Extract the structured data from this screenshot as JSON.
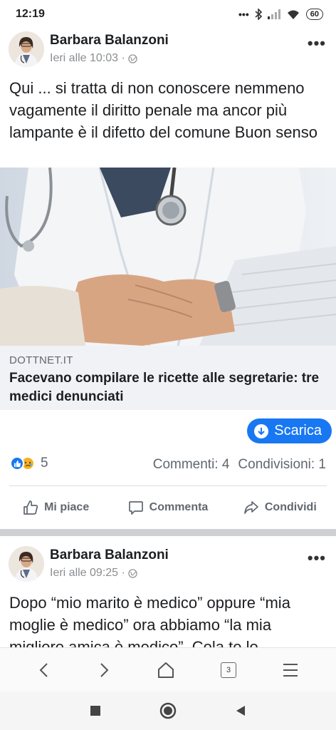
{
  "status_bar": {
    "time": "12:19",
    "battery": "60"
  },
  "posts": [
    {
      "author": "Barbara Balanzoni",
      "time": "Ieri alle 10:03 ·",
      "text": "Qui ... si tratta di non conoscere nemmeno vagamente il diritto penale ma ancor più lampante è il difetto del comune Buon senso"
    },
    {
      "author": "Barbara Balanzoni",
      "time": "Ieri alle 09:25 ·",
      "text": "Dopo “mio marito è medico” oppure “mia moglie è medico” ora abbiamo “la mia migliore amica è medico”. Cola te lo"
    }
  ],
  "link_preview": {
    "domain": "DOTTNET.IT",
    "title": "Facevano compilare le ricette alle segretarie: tre medici denunciati"
  },
  "download_button": "Scarica",
  "reactions": {
    "count": "5"
  },
  "stats": {
    "comments": "Commenti: 4",
    "shares": "Condivisioni: 1"
  },
  "actions": {
    "like": "Mi piace",
    "comment": "Commenta",
    "share": "Condividi"
  },
  "browser": {
    "tab_count": "3"
  },
  "icons": [
    "more-icon",
    "globe-icon",
    "like-icon",
    "comment-icon",
    "share-icon",
    "back-icon",
    "forward-icon",
    "home-icon",
    "tabs-icon",
    "menu-icon",
    "recents-icon",
    "home-button-icon",
    "back-triangle-icon"
  ],
  "colors": {
    "accent": "#1877f2",
    "muted": "#606770",
    "separator": "#ced0d4"
  }
}
